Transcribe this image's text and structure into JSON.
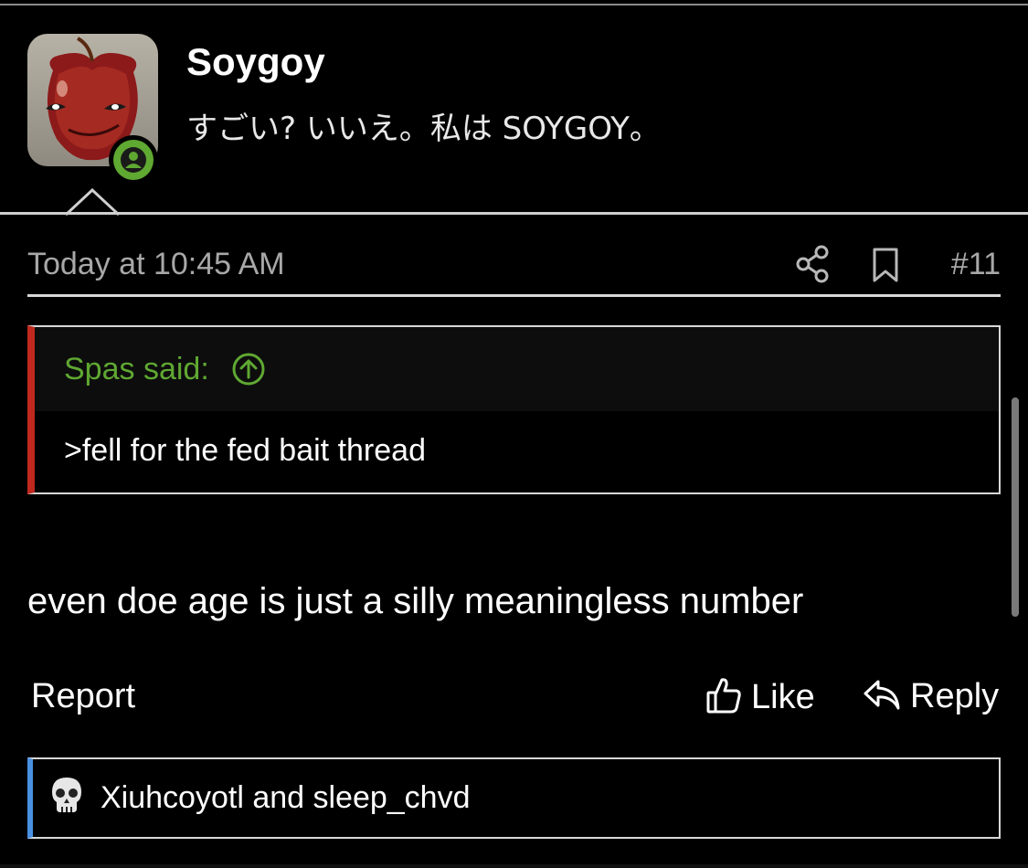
{
  "user": {
    "name": "Soygoy",
    "title": "すごい? いいえ。私は SOYGOY。"
  },
  "post": {
    "date": "Today at 10:45 AM",
    "number": "#11",
    "quote": {
      "author": "Spas said:",
      "text": ">fell for the fed bait thread"
    },
    "body": "even doe age is just a silly meaningless number"
  },
  "actions": {
    "report": "Report",
    "like": "Like",
    "reply": "Reply"
  },
  "reactions": {
    "text": "Xiuhcoyotl and sleep_chvd",
    "icon": "skull-reaction-icon"
  },
  "colors": {
    "background": "#000000",
    "online_badge": "#5fa832",
    "quote_author": "#5fa832",
    "quote_border": "#c0281e",
    "reaction_border": "#4a90e2",
    "muted_text": "#a8a8a8"
  }
}
